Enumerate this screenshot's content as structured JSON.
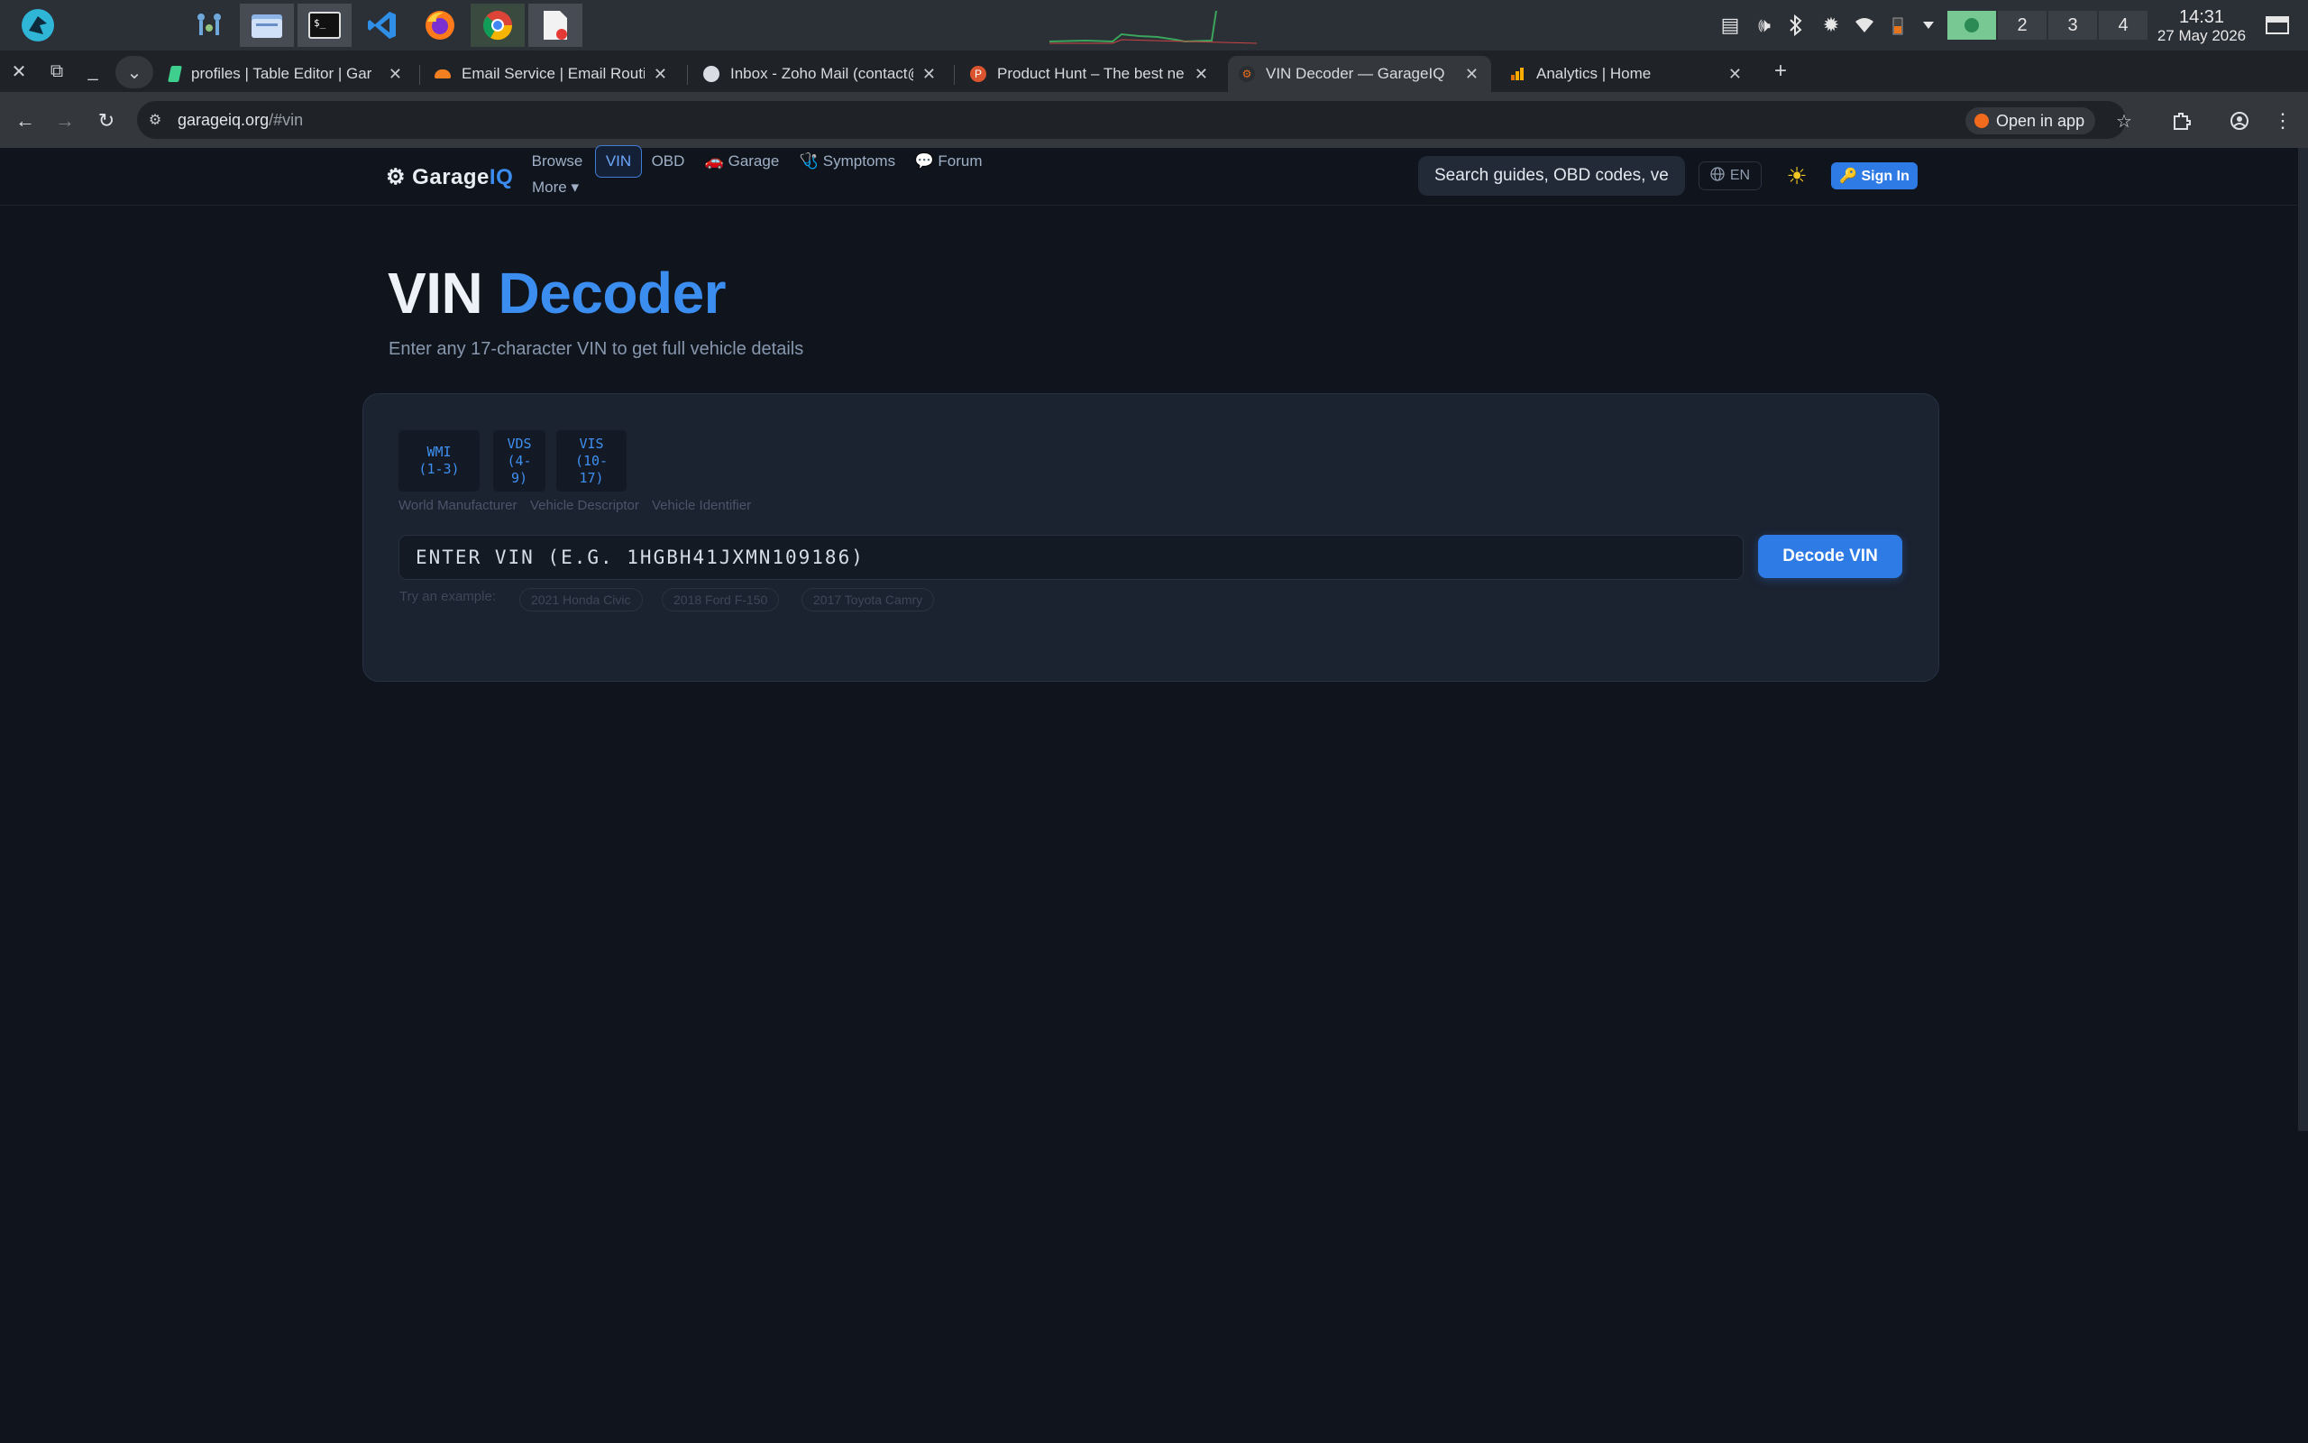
{
  "taskbar": {
    "launcher_icon": "raptor-logo-icon",
    "apps": [
      {
        "name": "nodes-app-icon"
      },
      {
        "name": "file-manager-icon"
      },
      {
        "name": "terminal-icon"
      },
      {
        "name": "vscode-icon"
      },
      {
        "name": "firefox-icon"
      },
      {
        "name": "chrome-icon"
      },
      {
        "name": "document-viewer-icon"
      }
    ],
    "workspaces": [
      "",
      "2",
      "3",
      "4"
    ],
    "clock_time": "14:31",
    "clock_date": "27 May 2026"
  },
  "browser": {
    "tabs": [
      {
        "title": "profiles | Table Editor | Gar",
        "favicon_color": "#3ecf8e",
        "active": false
      },
      {
        "title": "Email Service | Email Routi",
        "favicon_color": "#f38020",
        "active": false
      },
      {
        "title": "Inbox - Zoho Mail (contact@",
        "favicon_color": "#d9dde3",
        "active": false
      },
      {
        "title": "Product Hunt – The best ne",
        "favicon_color": "#da552f",
        "active": false
      },
      {
        "title": "VIN Decoder — GarageIQ",
        "favicon_color": "#3a3d42",
        "active": true
      },
      {
        "title": "Analytics | Home",
        "favicon_color": "#f9ab00",
        "active": false
      }
    ],
    "url_host": "garageiq.org",
    "url_path": "/#vin",
    "open_in_app": "Open in app"
  },
  "site": {
    "logo_main": "⚙ Garage",
    "logo_accent": "IQ",
    "nav": {
      "browse": "Browse",
      "vin": "VIN",
      "obd": "OBD",
      "garage": "🚗 Garage",
      "symptoms": "🩺 Symptoms",
      "forum": "💬 Forum",
      "more": "More ▾"
    },
    "search_placeholder": "Search guides, OBD codes, ve",
    "lang": "EN",
    "signin": "🔑 Sign In"
  },
  "hero": {
    "title_main": "VIN ",
    "title_accent": "Decoder",
    "subtitle": "Enter any 17-character VIN to get full vehicle details"
  },
  "decoder": {
    "segments": [
      {
        "code": "WMI",
        "range": "(1-3)"
      },
      {
        "code": "VDS",
        "range": "(4-9)"
      },
      {
        "code": "VIS",
        "range": "(10-17)"
      }
    ],
    "segment_labels": [
      "World Manufacturer",
      "Vehicle Descriptor",
      "Vehicle Identifier"
    ],
    "input_placeholder": "ENTER VIN (E.G. 1HGBH41JXMN109186)",
    "decode_button": "Decode VIN",
    "try_label": "Try an example:",
    "examples": [
      "2021 Honda Civic",
      "2018 Ford F-150",
      "2017 Toyota Camry"
    ]
  },
  "colors": {
    "accent": "#3b8ef0",
    "button": "#2f7be6",
    "page_bg": "#0f141d",
    "card_bg": "#1b2230"
  }
}
